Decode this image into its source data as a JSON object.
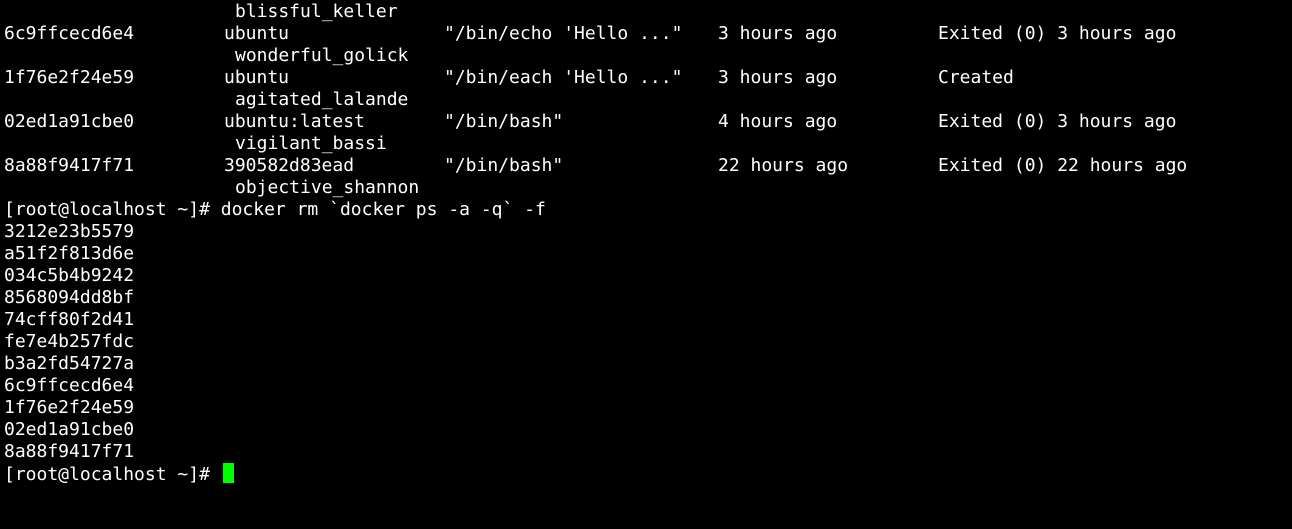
{
  "terminal": {
    "top_name": "blissful_keller",
    "containers": [
      {
        "id": "6c9ffcecd6e4",
        "image": "ubuntu",
        "command": "\"/bin/echo 'Hello ...\"",
        "created": "3 hours ago",
        "status": "Exited (0) 3 hours ago",
        "name": "wonderful_golick"
      },
      {
        "id": "1f76e2f24e59",
        "image": "ubuntu",
        "command": "\"/bin/each 'Hello ...\"",
        "created": "3 hours ago",
        "status": "Created",
        "name": "agitated_lalande"
      },
      {
        "id": "02ed1a91cbe0",
        "image": "ubuntu:latest",
        "command": "\"/bin/bash\"",
        "created": "4 hours ago",
        "status": "Exited (0) 3 hours ago",
        "name": "vigilant_bassi"
      },
      {
        "id": "8a88f9417f71",
        "image": "390582d83ead",
        "command": "\"/bin/bash\"",
        "created": "22 hours ago",
        "status": "Exited (0) 22 hours ago",
        "name": "objective_shannon"
      }
    ],
    "command_line": "[root@localhost ~]# docker rm `docker ps -a -q` -f",
    "removed_ids": [
      "3212e23b5579",
      "a51f2f813d6e",
      "034c5b4b9242",
      "8568094dd8bf",
      "74cff80f2d41",
      "fe7e4b257fdc",
      "b3a2fd54727a",
      "6c9ffcecd6e4",
      "1f76e2f24e59",
      "02ed1a91cbe0",
      "8a88f9417f71"
    ],
    "prompt": "[root@localhost ~]# ",
    "colors": {
      "background": "#000000",
      "foreground": "#ffffff",
      "cursor": "#00ff00"
    }
  }
}
